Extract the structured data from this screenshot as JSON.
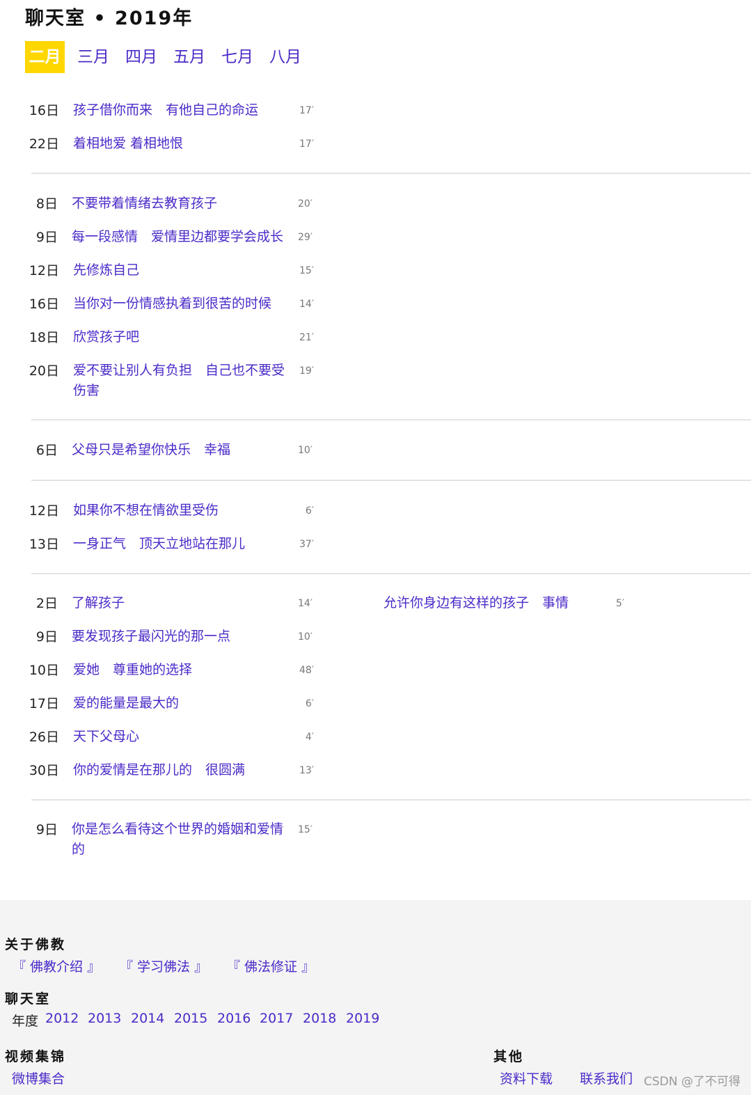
{
  "page": {
    "title": "聊天室 • 2019年"
  },
  "month_tabs": [
    {
      "label": "二月",
      "active": true
    },
    {
      "label": "三月",
      "active": false
    },
    {
      "label": "四月",
      "active": false
    },
    {
      "label": "五月",
      "active": false
    },
    {
      "label": "七月",
      "active": false
    },
    {
      "label": "八月",
      "active": false
    }
  ],
  "groups": [
    {
      "entries": [
        {
          "day": "16日",
          "title": "孩子借你而来　有他自己的命运",
          "duration": "17′"
        },
        {
          "day": "22日",
          "title": "着相地爱 着相地恨",
          "duration": "17′"
        }
      ]
    },
    {
      "entries": [
        {
          "day": "8日",
          "title": "不要带着情绪去教育孩子",
          "duration": "20′"
        },
        {
          "day": "9日",
          "title": "每一段感情　爱情里边都要学会成长",
          "duration": "29′"
        },
        {
          "day": "12日",
          "title": "先修炼自己",
          "duration": "15′"
        },
        {
          "day": "16日",
          "title": "当你对一份情感执着到很苦的时候",
          "duration": "14′"
        },
        {
          "day": "18日",
          "title": "欣赏孩子吧",
          "duration": "21′"
        },
        {
          "day": "20日",
          "title": "爱不要让别人有负担　自己也不要受伤害",
          "duration": "19′"
        }
      ]
    },
    {
      "entries": [
        {
          "day": "6日",
          "title": "父母只是希望你快乐　幸福",
          "duration": "10′"
        }
      ]
    },
    {
      "entries": [
        {
          "day": "12日",
          "title": "如果你不想在情欲里受伤",
          "duration": "6′"
        },
        {
          "day": "13日",
          "title": "一身正气　顶天立地站在那儿",
          "duration": "37′"
        }
      ]
    },
    {
      "entries": [
        {
          "day": "2日",
          "title": "了解孩子",
          "duration": "14′"
        },
        {
          "day": "9日",
          "title": "要发现孩子最闪光的那一点",
          "duration": "10′"
        },
        {
          "day": "10日",
          "title": "爱她　尊重她的选择",
          "duration": "48′"
        },
        {
          "day": "17日",
          "title": "爱的能量是最大的",
          "duration": "6′"
        },
        {
          "day": "26日",
          "title": "天下父母心",
          "duration": "4′"
        },
        {
          "day": "30日",
          "title": "你的爱情是在那儿的　很圆满",
          "duration": "13′"
        }
      ],
      "extra": {
        "title": "允许你身边有这样的孩子　事情",
        "duration": "5′"
      }
    },
    {
      "entries": [
        {
          "day": "9日",
          "title": "你是怎么看待这个世界的婚姻和爱情的",
          "duration": "15′"
        }
      ]
    }
  ],
  "footer": {
    "about": {
      "heading": "关于佛教",
      "links": [
        "『 佛教介绍 』",
        "『 学习佛法 』",
        "『 佛法修证 』"
      ]
    },
    "chatroom": {
      "heading": "聊天室",
      "year_label": "年度",
      "years": [
        "2012",
        "2013",
        "2014",
        "2015",
        "2016",
        "2017",
        "2018",
        "2019"
      ]
    },
    "video": {
      "heading": "视频集锦",
      "links": [
        "微博集合"
      ]
    },
    "other": {
      "heading": "其他",
      "links": [
        "资料下载",
        "联系我们"
      ]
    },
    "watermark": "CSDN @了不可得"
  }
}
